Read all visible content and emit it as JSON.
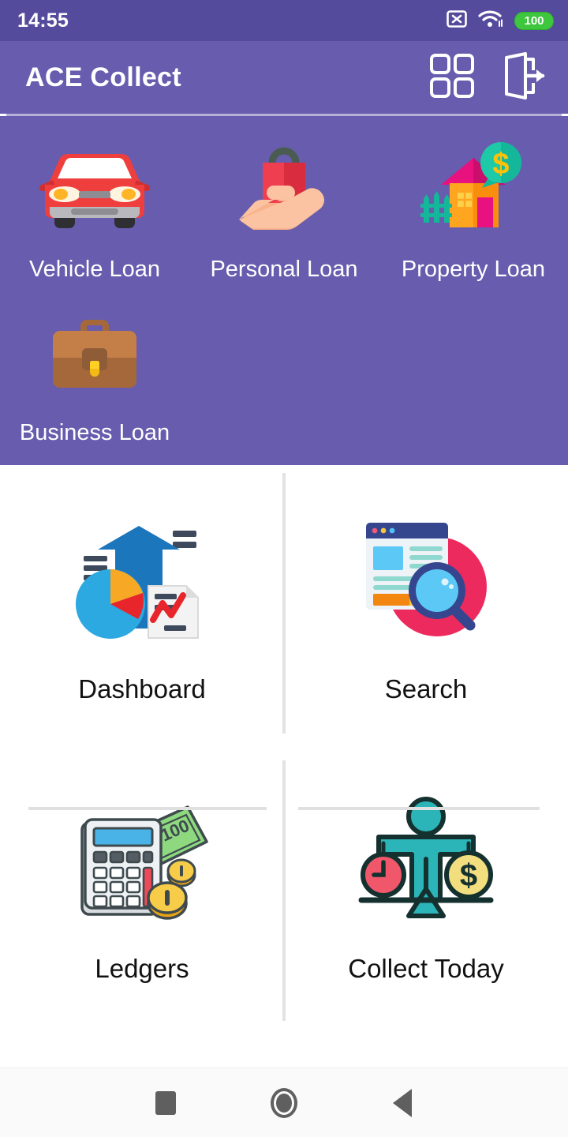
{
  "status_bar": {
    "time": "14:55",
    "sim_icon": "sim-card-off-icon",
    "wifi_icon": "wifi-icon",
    "battery_level": "100",
    "battery_color": "#3fc63f"
  },
  "app_bar": {
    "title": "ACE Collect",
    "background_color": "#685cae",
    "actions": [
      {
        "name": "apps-grid-icon",
        "label": "Apps"
      },
      {
        "name": "logout-icon",
        "label": "Logout"
      }
    ]
  },
  "loan_panel": {
    "background_color": "#685cae",
    "items": [
      {
        "label": "Vehicle Loan",
        "icon": "car-icon"
      },
      {
        "label": "Personal Loan",
        "icon": "hand-shopping-bag-icon"
      },
      {
        "label": "Property Loan",
        "icon": "house-dollar-icon"
      },
      {
        "label": "Business Loan",
        "icon": "briefcase-icon"
      }
    ]
  },
  "menu_grid": {
    "items": [
      {
        "label": "Dashboard",
        "icon": "growth-arrow-chart-icon"
      },
      {
        "label": "Search",
        "icon": "browser-magnifier-icon"
      },
      {
        "label": "Ledgers",
        "icon": "calculator-money-icon"
      },
      {
        "label": "Collect Today",
        "icon": "balance-scale-icon"
      }
    ]
  },
  "nav_bar": {
    "buttons": [
      {
        "name": "recents-button",
        "label": "Recents"
      },
      {
        "name": "home-button",
        "label": "Home"
      },
      {
        "name": "back-button",
        "label": "Back"
      }
    ]
  }
}
